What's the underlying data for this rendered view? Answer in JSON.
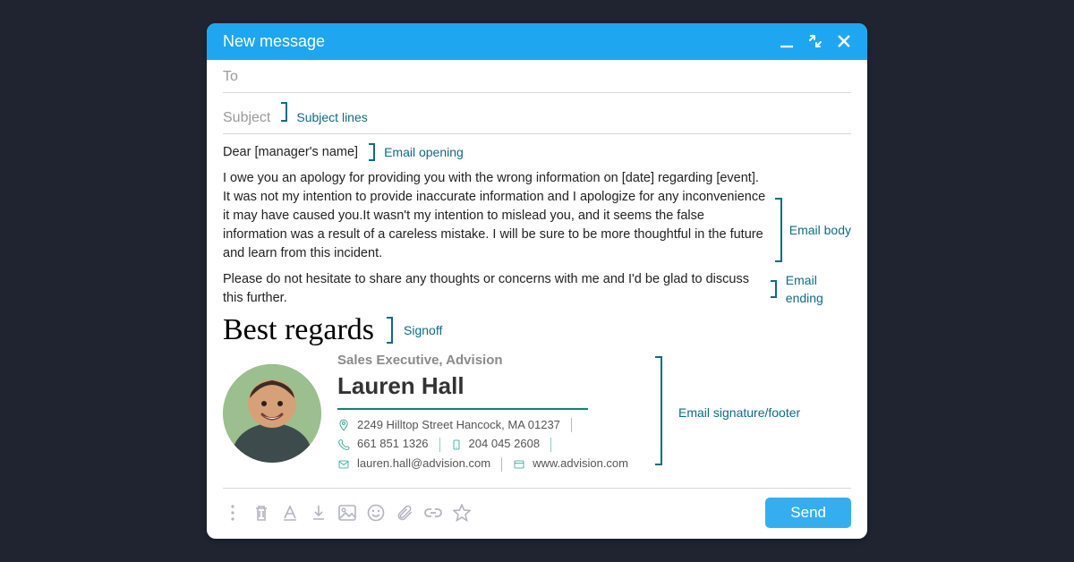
{
  "header": {
    "title": "New message"
  },
  "fields": {
    "to_label": "To",
    "subject_label": "Subject"
  },
  "annotations": {
    "subject": "Subject lines",
    "opening": "Email opening",
    "body": "Email body",
    "ending": "Email ending",
    "signoff": "Signoff",
    "signature": "Email signature/footer"
  },
  "email": {
    "greeting": "Dear [manager's name]",
    "body": "I owe you an apology for providing you with the wrong information on [date] regarding [event]. It was not my intention to provide inaccurate information and I apologize for any inconvenience it may have caused you.It wasn't my intention to mislead you, and it seems the false information was a result of a careless mistake. I will be sure to be more thoughtful in the future and learn from this incident.",
    "ending": "Please do not hesitate to share any thoughts or concerns with me and I'd be glad to discuss this further.",
    "signoff": "Best regards"
  },
  "signature": {
    "title": "Sales Executive, Advision",
    "name": "Lauren Hall",
    "address": "2249 Hilltop Street Hancock, MA 01237",
    "phone1": "661 851 1326",
    "phone2": "204 045 2608",
    "email": "lauren.hall@advision.com",
    "website": "www.advision.com"
  },
  "send": "Send"
}
